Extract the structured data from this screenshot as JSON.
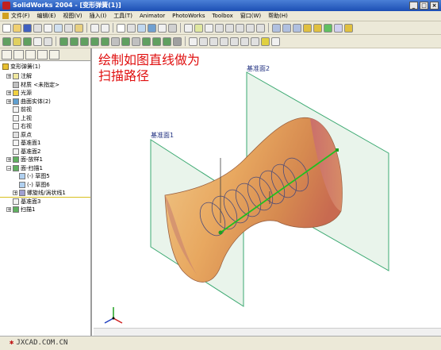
{
  "window": {
    "title": "SolidWorks 2004 - [变形弹簧(1)]",
    "controls": [
      "_",
      "□",
      "×"
    ]
  },
  "menu": [
    "文件(F)",
    "编辑(E)",
    "视图(V)",
    "插入(I)",
    "工具(T)",
    "Animator",
    "PhotoWorks",
    "Toolbox",
    "窗口(W)",
    "帮助(H)"
  ],
  "tree": {
    "root": "变形弹簧(1)",
    "items": [
      {
        "label": "注解",
        "icon": "annotation-icon",
        "indent": 1,
        "expand": true
      },
      {
        "label": "材质 <未指定>",
        "icon": "material-icon",
        "indent": 1,
        "expand": false
      },
      {
        "label": "光源",
        "icon": "lights-icon",
        "indent": 1,
        "expand": true
      },
      {
        "label": "曲面实体(2)",
        "icon": "surface-bodies-icon",
        "indent": 1,
        "expand": true
      },
      {
        "label": "前视",
        "icon": "plane-icon",
        "indent": 1,
        "expand": false
      },
      {
        "label": "上视",
        "icon": "plane-icon",
        "indent": 1,
        "expand": false
      },
      {
        "label": "右视",
        "icon": "plane-icon",
        "indent": 1,
        "expand": false
      },
      {
        "label": "原点",
        "icon": "origin-icon",
        "indent": 1,
        "expand": false
      },
      {
        "label": "基准面1",
        "icon": "plane-icon",
        "indent": 1,
        "expand": false
      },
      {
        "label": "基准面2",
        "icon": "plane-icon",
        "indent": 1,
        "expand": false
      },
      {
        "label": "面-放样1",
        "icon": "loft-icon",
        "indent": 1,
        "expand": true
      },
      {
        "label": "面-扫描1",
        "icon": "sweep-icon",
        "indent": 1,
        "expand": true,
        "expanded": true
      },
      {
        "label": "(-) 草图5",
        "icon": "sketch-icon",
        "indent": 2,
        "expand": false
      },
      {
        "label": "(-) 草图6",
        "icon": "sketch-icon",
        "indent": 2,
        "expand": false
      },
      {
        "label": "螺旋线/涡状线1",
        "icon": "helix-icon",
        "indent": 2,
        "expand": true
      },
      {
        "label": "基准面3",
        "icon": "plane-icon",
        "indent": 1,
        "expand": false
      },
      {
        "label": "扫描1",
        "icon": "sweep-icon",
        "indent": 1,
        "expand": true
      }
    ]
  },
  "viewport": {
    "instruction": "绘制如图直线做为\n扫描路径",
    "instruction_line1": "绘制如图直线做为",
    "instruction_line2": "扫描路径",
    "plane1_label": "基准面1",
    "plane2_label": "基准面2",
    "instruction_color": "#e01010",
    "plane_color": "#3aa870",
    "surface_color": "#e8b060"
  },
  "watermark": "JXCAD.COM.CN"
}
